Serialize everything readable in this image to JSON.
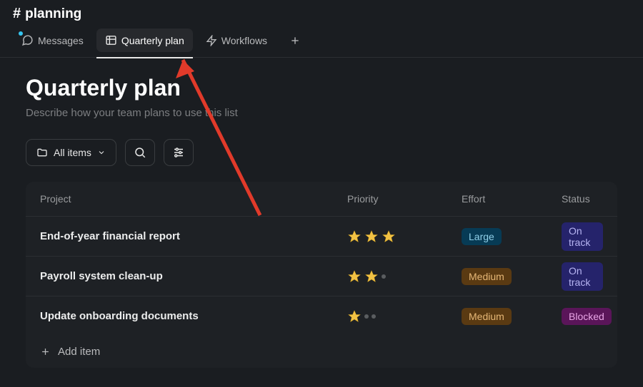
{
  "channel": {
    "prefix": "#",
    "name": "planning"
  },
  "tabs": [
    {
      "label": "Messages",
      "icon": "messages-icon",
      "has_dot": true
    },
    {
      "label": "Quarterly plan",
      "icon": "list-icon",
      "active": true
    },
    {
      "label": "Workflows",
      "icon": "bolt-icon"
    }
  ],
  "page": {
    "title": "Quarterly plan",
    "subtitle": "Describe how your team plans to use this list"
  },
  "toolbar": {
    "view_label": "All items",
    "search_icon": "search-icon",
    "filter_icon": "filter-icon"
  },
  "columns": [
    "Project",
    "Priority",
    "Effort",
    "Status"
  ],
  "effort_styles": {
    "Large": {
      "bg": "#073b55",
      "fg": "#8fcfe8"
    },
    "Medium": {
      "bg": "#5a3a12",
      "fg": "#e6b776"
    }
  },
  "status_styles": {
    "On track": {
      "bg": "#25236b",
      "fg": "#b6b4f2"
    },
    "Blocked": {
      "bg": "#5a1559",
      "fg": "#e9a5e6"
    }
  },
  "rows": [
    {
      "project": "End-of-year financial report",
      "priority": 3,
      "effort": "Large",
      "status": "On track"
    },
    {
      "project": "Payroll system clean-up",
      "priority": 2,
      "effort": "Medium",
      "status": "On track"
    },
    {
      "project": "Update onboarding documents",
      "priority": 1,
      "effort": "Medium",
      "status": "Blocked"
    }
  ],
  "add_item_label": "Add item",
  "annotation": {
    "arrow_color": "#e13a2a"
  }
}
